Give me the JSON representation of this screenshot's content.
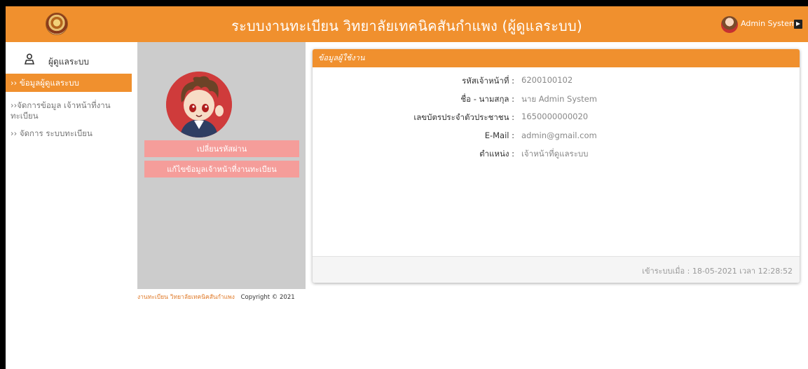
{
  "header": {
    "title": "ระบบงานทะเบียน วิทยาลัยเทคนิคสันกำแพง (ผู้ดูแลระบบ)",
    "user_name": "Admin System",
    "logo_icon": "college-seal-icon",
    "logout_icon": "logout-icon"
  },
  "sidebar": {
    "header_label": "ผู้ดูแลระบบ",
    "header_icon": "person-icon",
    "items": [
      {
        "label": "›› ข้อมูลผู้ดูแลระบบ",
        "active": true
      },
      {
        "label": "››จัดการข้อมูล เจ้าหน้าที่งาน",
        "label2": "ทะเบียน",
        "active": false
      },
      {
        "label": "›› จัดการ ระบบทะเบียน",
        "active": false
      }
    ]
  },
  "profile": {
    "change_password_label": "เปลี่ยนรหัสผ่าน",
    "edit_staff_label": "แก้ไขข้อมูลเจ้าหน้าที่งานทะเบียน"
  },
  "panel": {
    "title": "ข้อมูลผู้ใช้งาน",
    "fields": [
      {
        "label": "รหัสเจ้าหน้าที่ :",
        "value": "6200100102"
      },
      {
        "label": "ชื่อ - นามสกุล :",
        "value": "นาย Admin System"
      },
      {
        "label": "เลขบัตรประจำตัวประชาชน :",
        "value": "1650000000020"
      },
      {
        "label": "E-Mail :",
        "value": "admin@gmail.com"
      },
      {
        "label": "ตำแหน่ง :",
        "value": "เจ้าหน้าที่ดูแลระบบ"
      }
    ],
    "last_login": "เข้าระบบเมื่อ : 18-05-2021 เวลา 12:28:52"
  },
  "footer": {
    "org_text": "งานทะเบียน วิทยาลัยเทคนิคสันกำแพง",
    "copyright": "Copyright © 2021"
  },
  "colors": {
    "accent": "#f0902e",
    "pink_button": "#f59d9a",
    "grey_column": "#cccccc"
  }
}
